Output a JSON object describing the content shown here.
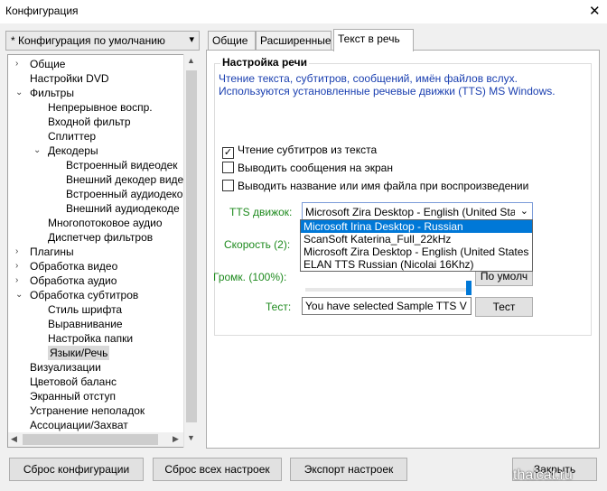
{
  "window": {
    "title": "Конфигурация",
    "close_glyph": "✕"
  },
  "profile": {
    "value": "* Конфигурация по умолчанию",
    "arrow": "▾"
  },
  "tree": {
    "items": [
      {
        "label": "Общие"
      },
      {
        "label": "Настройки DVD"
      },
      {
        "label": "Фильтры"
      },
      {
        "label": "Непрерывное воспр."
      },
      {
        "label": "Входной фильтр"
      },
      {
        "label": "Сплиттер"
      },
      {
        "label": "Декодеры"
      },
      {
        "label": "Встроенный видеодек"
      },
      {
        "label": "Внешний декодер виде"
      },
      {
        "label": "Встроенный аудиодеко"
      },
      {
        "label": "Внешний аудиодекоде"
      },
      {
        "label": "Многопотоковое аудио"
      },
      {
        "label": "Диспетчер фильтров"
      },
      {
        "label": "Плагины"
      },
      {
        "label": "Обработка видео"
      },
      {
        "label": "Обработка аудио"
      },
      {
        "label": "Обработка субтитров"
      },
      {
        "label": "Стиль шрифта"
      },
      {
        "label": "Выравнивание"
      },
      {
        "label": "Настройка папки"
      },
      {
        "label": "Языки/Речь",
        "selected": true
      },
      {
        "label": "Визуализации"
      },
      {
        "label": "Цветовой баланс"
      },
      {
        "label": "Экранный отступ"
      },
      {
        "label": "Устранение неполадок"
      },
      {
        "label": "Ассоциации/Захват"
      }
    ]
  },
  "tabs": [
    {
      "label": "Общие"
    },
    {
      "label": "Расширенные"
    },
    {
      "label": "Текст в речь",
      "active": true
    }
  ],
  "speech": {
    "group_title": "Настройка речи",
    "description": "Чтение текста, субтитров, сообщений, имён файлов вслух. Используются установленные речевые движки (TTS) MS Windows.",
    "checks": [
      {
        "label": "Чтение субтитров из текста",
        "checked": true
      },
      {
        "label": "Выводить сообщения на экран",
        "checked": false
      },
      {
        "label": "Выводить название или имя файла при воспроизведении",
        "checked": false
      }
    ],
    "tts_label": "TTS движок:",
    "tts_value": "Microsoft Zira Desktop - English (United Sta",
    "tts_options": [
      "Microsoft Irina Desktop - Russian",
      "ScanSoft Katerina_Full_22kHz",
      "Microsoft Zira Desktop - English (United States",
      "ELAN TTS Russian (Nicolai 16Khz)"
    ],
    "speed_label": "Скорость (2):",
    "volume_label": "Громк. (100%):",
    "volume_value": 100,
    "default_button": "По умолч",
    "test_label": "Тест:",
    "test_value": "You have selected Sample TTS V",
    "test_button": "Тест"
  },
  "bottom": {
    "reset_config": "Сброс конфигурации",
    "reset_all": "Сброс всех настроек",
    "export": "Экспорт настроек",
    "close": "Закрыть"
  },
  "watermark": "thaicat.ru"
}
